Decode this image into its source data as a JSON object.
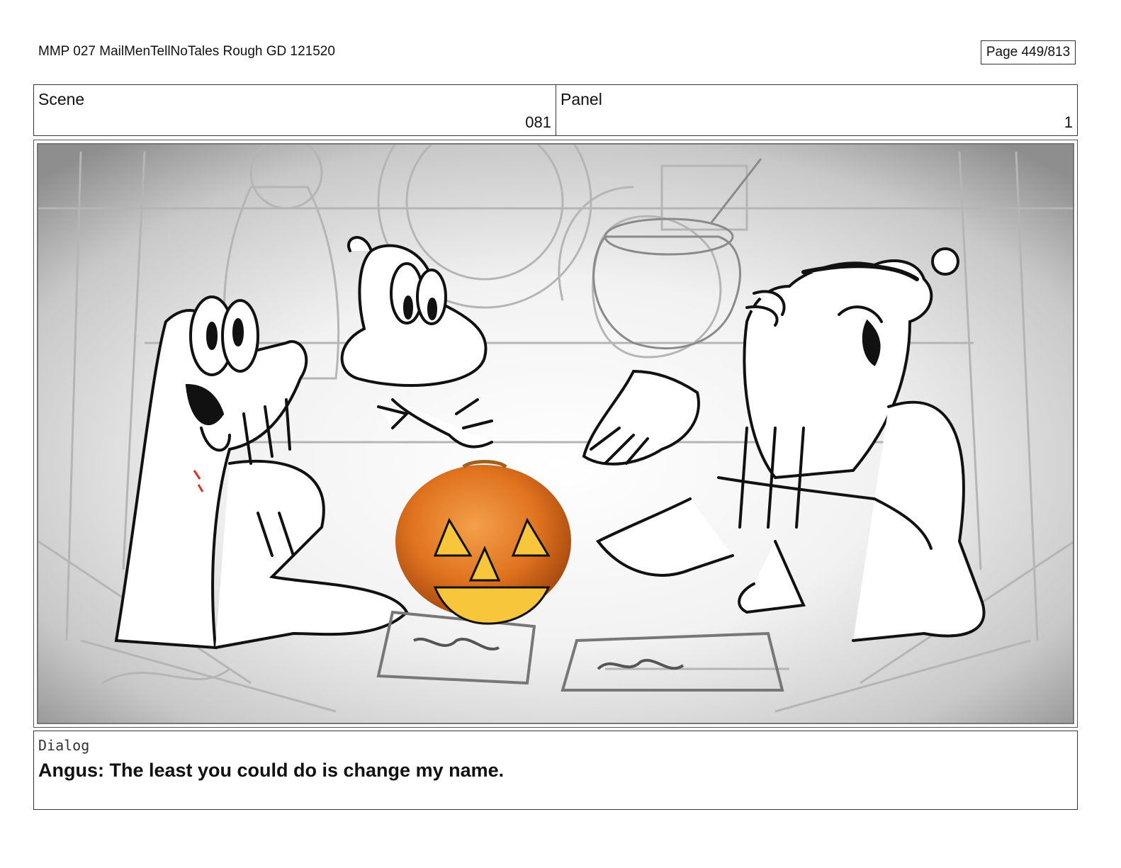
{
  "header": {
    "document_title": "MMP 027 MailMenTellNoTales Rough GD 121520",
    "page_label": "Page 449/813"
  },
  "info": {
    "scene_label": "Scene",
    "scene_number": "081",
    "panel_label": "Panel",
    "panel_number": "1"
  },
  "dialog": {
    "label": "Dialog",
    "text": "Angus: The least you could do is change my name."
  },
  "colors": {
    "pumpkin": "#e0731f",
    "pumpkin_glow": "#f7c63a",
    "sketch_line": "#111111",
    "background_sketch": "#9a9a9a"
  }
}
